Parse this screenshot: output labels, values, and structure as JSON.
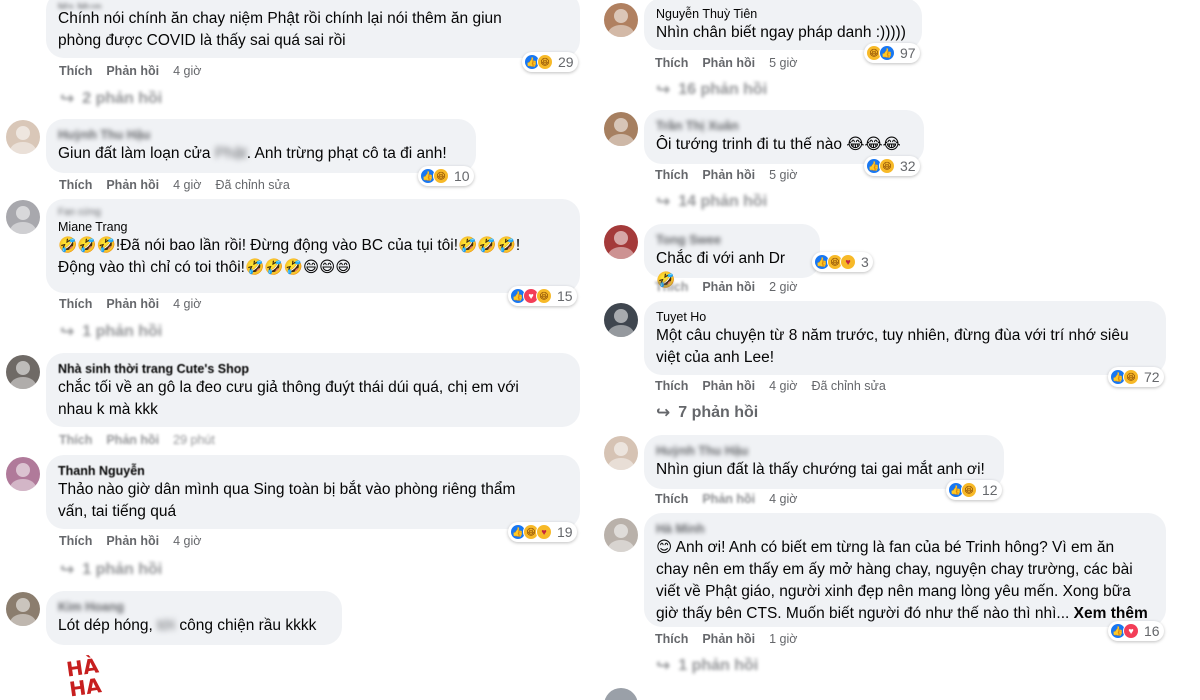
{
  "ui": {
    "like": "Thích",
    "reply": "Phản hồi",
    "edited": "Đã chỉnh sửa",
    "see_more": "Xem thêm",
    "reply_arrow": "↪"
  },
  "colors": {
    "bubble": "#f0f2f5",
    "meta_text": "#65676b",
    "like_blue": "#1877f2",
    "haha_yellow": "#f7b928",
    "love_red": "#f33e58",
    "sticker_red": "#c71f1f"
  },
  "left": {
    "c1": {
      "text_a": "Chính nói chính ăn chay niệm Phật rồi chính lại nói thêm ăn giun",
      "text_b": "phòng được COVID là thấy sai quá sai rồi",
      "reactions": [
        "like",
        "haha"
      ],
      "count": "29",
      "time": "4 giờ",
      "replies": "2 phản hồi"
    },
    "c2": {
      "author": "Huỳnh Thu Hậu",
      "text_pre": "Giun đất làm loạn cửa ",
      "text_blur": "Phật",
      "text_post": ". Anh trừng phạt cô ta đi anh!",
      "reactions": [
        "like",
        "haha"
      ],
      "count": "10",
      "time": "4 giờ"
    },
    "c3": {
      "tag": "Fan cứng",
      "author": "Miane Trang",
      "text_a": "🤣🤣🤣!Đã nói bao lần rồi! Đừng động vào BC của tụi tôi!🤣🤣🤣!",
      "text_b": "Động vào thì chỉ có toi thôi!🤣🤣🤣😄😄😄",
      "reactions": [
        "like",
        "love",
        "haha"
      ],
      "count": "15",
      "time": "4 giờ",
      "replies": "1 phản hồi"
    },
    "c4": {
      "author": "Nhà sinh thời trang Cute's Shop",
      "text_a": "chắc tối về an gô la đeo cưu giả thông đuýt thái dúi quá, chị em với",
      "text_b": "nhau k mà kkk",
      "time": "29 phút"
    },
    "c5": {
      "author": "Thanh Nguyễn",
      "text_a": "Thảo nào giờ dân mình qua Sing toàn bị bắt vào phòng riêng thẩm",
      "text_b": "vấn, tai tiếng quá",
      "reactions": [
        "like",
        "haha",
        "care"
      ],
      "count": "19",
      "time": "4 giờ",
      "replies": "1 phản hồi"
    },
    "c6": {
      "author": "Kim Hoang",
      "text_pre": "Lót dép hóng, ",
      "text_blur": "tới",
      "text_post": " công chiện rầu kkkk"
    },
    "sticker": {
      "l1": "HÀ",
      "l2": "HA"
    }
  },
  "right": {
    "c1": {
      "author": "Nguyễn Thuỳ Tiên",
      "text_a": "Nhìn chân biết ngay pháp danh :)))))",
      "reactions": [
        "haha",
        "like"
      ],
      "count": "97",
      "time": "5 giờ",
      "replies": "16 phản hồi"
    },
    "c2": {
      "author": "Trần Thị Xuân",
      "text_a": "Ôi tướng trinh đi tu thế nào 😂😂😂",
      "reactions": [
        "like",
        "haha"
      ],
      "count": "32",
      "time": "5 giờ",
      "replies": "14 phản hồi"
    },
    "c3": {
      "author": "Tong Swee",
      "text_a": "Chắc đi với anh Dr 🤣",
      "reactions": [
        "like",
        "haha",
        "care"
      ],
      "count": "3",
      "time": "2 giờ"
    },
    "c4": {
      "author": "Tuyet Ho",
      "text_a": "Một câu chuyện từ 8 năm trước, tuy nhiên, đừng đùa với trí nhớ siêu",
      "text_b": "việt của anh Lee!",
      "reactions": [
        "like",
        "haha"
      ],
      "count": "72",
      "time": "4 giờ",
      "replies": "7 phản hồi"
    },
    "c5": {
      "author": "Huỳnh Thu Hậu",
      "text_a": "Nhìn giun đất là thấy chướng tai gai mắt anh ơi!",
      "reactions": [
        "like",
        "haha"
      ],
      "count": "12",
      "time": "4 giờ"
    },
    "c6": {
      "author": "Hà Minh",
      "text_a": "😊 Anh ơi! Anh có biết em từng là fan của bé Trinh hông? Vì em ăn",
      "text_b": "chay nên em thấy em ấy mở hàng chay, nguyện chay trường, các bài",
      "text_c": "viết về Phật giáo, người xinh đẹp nên mang lòng yêu mến. Xong bữa",
      "text_d": "giờ thấy bên CTS. Muốn biết người đó như thế nào thì nhì...",
      "reactions": [
        "like",
        "love"
      ],
      "count": "16",
      "time": "1 giờ",
      "replies": "1 phản hồi"
    }
  }
}
